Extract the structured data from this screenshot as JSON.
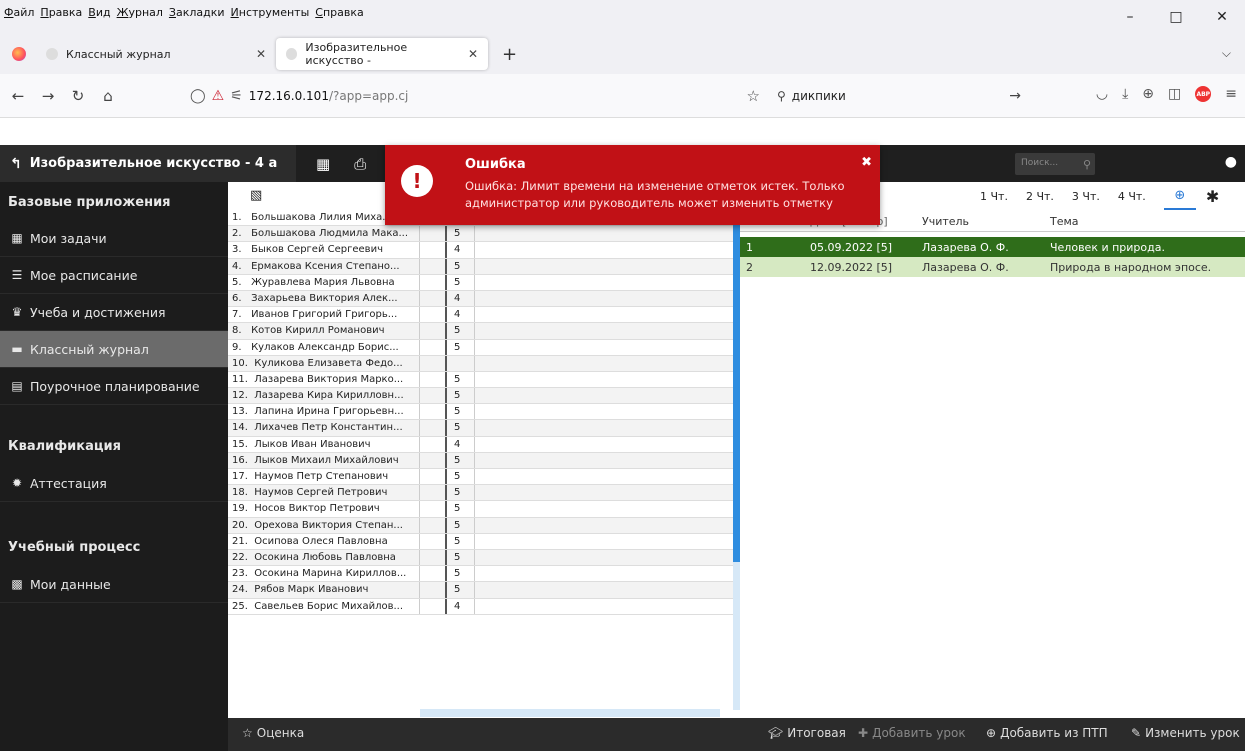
{
  "browser": {
    "menu": [
      "Файл",
      "Правка",
      "Вид",
      "Журнал",
      "Закладки",
      "Инструменты",
      "Справка"
    ],
    "window_controls": [
      "–",
      "□",
      "✕"
    ],
    "tabs": [
      {
        "title": "Классный журнал",
        "close": "✕"
      },
      {
        "title": "Изобразительное искусство -",
        "close": "✕"
      }
    ],
    "new_tab": "+",
    "url_host": "172.16.0.101",
    "url_path": "/?app=app.cj",
    "search_value": "дикпики",
    "colors": {
      "chrome": "#f0f0f4"
    }
  },
  "app": {
    "title": "Изобразительное искусство - 4 а",
    "search_placeholder": "Поиск...",
    "colors": {
      "header": "#1f1f1f",
      "sidebar": "#1c1c1c",
      "active_item": "#6b6b6b",
      "error": "#c11116",
      "lesson_selected": "#2f6d1a",
      "lesson_alt": "#d6e9c2"
    }
  },
  "sidebar": {
    "sections": [
      {
        "title": "Базовые приложения",
        "items": [
          {
            "label": "Мои задачи",
            "icon": "calendar-icon"
          },
          {
            "label": "Мое расписание",
            "icon": "list-icon"
          },
          {
            "label": "Учеба и достижения",
            "icon": "trophy-icon"
          },
          {
            "label": "Классный журнал",
            "icon": "book-icon",
            "active": true
          },
          {
            "label": "Поурочное планирование",
            "icon": "document-icon"
          }
        ]
      },
      {
        "title": "Квалификация",
        "items": [
          {
            "label": "Аттестация",
            "icon": "badge-icon"
          }
        ]
      },
      {
        "title": "Учебный процесс",
        "items": [
          {
            "label": "Мои данные",
            "icon": "id-card-icon"
          }
        ]
      }
    ]
  },
  "students": [
    {
      "n": "1.",
      "name": "Большакова Лилия Миха...",
      "grade": ""
    },
    {
      "n": "2.",
      "name": "Большакова Людмила Мака...",
      "grade": "5"
    },
    {
      "n": "3.",
      "name": "Быков Сергей Сергеевич",
      "grade": "4"
    },
    {
      "n": "4.",
      "name": "Ермакова Ксения Степано...",
      "grade": "5"
    },
    {
      "n": "5.",
      "name": "Журавлева Мария Львовна",
      "grade": "5"
    },
    {
      "n": "6.",
      "name": "Захарьева Виктория Алек...",
      "grade": "4"
    },
    {
      "n": "7.",
      "name": "Иванов Григорий Григорь...",
      "grade": "4"
    },
    {
      "n": "8.",
      "name": "Котов Кирилл Романович",
      "grade": "5"
    },
    {
      "n": "9.",
      "name": "Кулаков Александр Борис...",
      "grade": "5"
    },
    {
      "n": "10.",
      "name": "Куликова Елизавета Федо...",
      "grade": ""
    },
    {
      "n": "11.",
      "name": "Лазарева Виктория Марко...",
      "grade": "5"
    },
    {
      "n": "12.",
      "name": "Лазарева Кира Кирилловн...",
      "grade": "5"
    },
    {
      "n": "13.",
      "name": "Лапина Ирина Григорьевн...",
      "grade": "5"
    },
    {
      "n": "14.",
      "name": "Лихачев Петр Константин...",
      "grade": "5"
    },
    {
      "n": "15.",
      "name": "Лыков Иван Иванович",
      "grade": "4"
    },
    {
      "n": "16.",
      "name": "Лыков Михаил Михайлович",
      "grade": "5"
    },
    {
      "n": "17.",
      "name": "Наумов Петр Степанович",
      "grade": "5"
    },
    {
      "n": "18.",
      "name": "Наумов Сергей Петрович",
      "grade": "5"
    },
    {
      "n": "19.",
      "name": "Носов Виктор Петрович",
      "grade": "5"
    },
    {
      "n": "20.",
      "name": "Орехова Виктория Степан...",
      "grade": "5"
    },
    {
      "n": "21.",
      "name": "Осипова Олеся Павловна",
      "grade": "5"
    },
    {
      "n": "22.",
      "name": "Осокина Любовь Павловна",
      "grade": "5"
    },
    {
      "n": "23.",
      "name": "Осокина Марина Кириллов...",
      "grade": "5"
    },
    {
      "n": "24.",
      "name": "Рябов Марк Иванович",
      "grade": "5"
    },
    {
      "n": "25.",
      "name": "Савельев Борис Михайлов...",
      "grade": "4"
    }
  ],
  "quarters": [
    "1 Чт.",
    "2 Чт.",
    "3 Чт.",
    "4 Чт."
  ],
  "lessons": {
    "headers": [
      "№",
      "Дата [Номер]",
      "Учитель",
      "Тема"
    ],
    "rows": [
      {
        "n": "1",
        "date": "05.09.2022 [5]",
        "teacher": "Лазарева О. Ф.",
        "topic": "Человек и природа."
      },
      {
        "n": "2",
        "date": "12.09.2022 [5]",
        "teacher": "Лазарева О. Ф.",
        "topic": "Природа в народном эпосе."
      }
    ]
  },
  "bottom": {
    "grade": "Оценка",
    "final": "Итоговая",
    "add_lesson": "Добавить урок",
    "add_from_ptp": "Добавить из ПТП",
    "edit_lesson": "Изменить урок"
  },
  "error": {
    "title": "Ошибка",
    "message": "Ошибка: Лимит времени на изменение отметок истек. Только администратор или руководитель может изменить отметку"
  }
}
